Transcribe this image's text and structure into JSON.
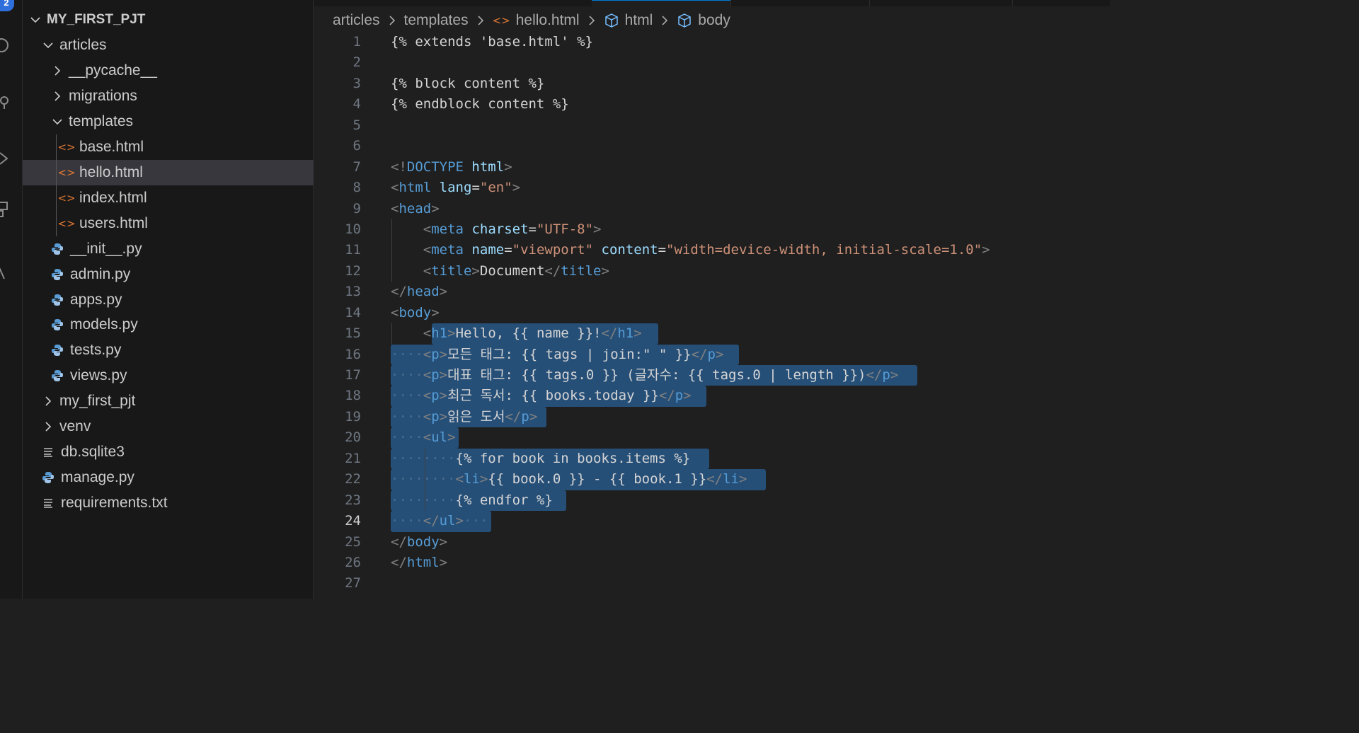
{
  "activity_bar": {
    "badge": "2",
    "icons": [
      "search-icon",
      "source-control-icon",
      "run-debug-icon",
      "extensions-icon",
      "testing-icon"
    ]
  },
  "explorer": {
    "root": "MY_FIRST_PJT",
    "items": [
      {
        "label": "articles",
        "kind": "folder-open",
        "name": "tree-folder-articles"
      },
      {
        "label": "__pycache__",
        "kind": "folder",
        "name": "tree-folder-pycache"
      },
      {
        "label": "migrations",
        "kind": "folder",
        "name": "tree-folder-migrations"
      },
      {
        "label": "templates",
        "kind": "folder-open",
        "name": "tree-folder-templates"
      },
      {
        "label": "base.html",
        "kind": "html",
        "name": "tree-file-base-html"
      },
      {
        "label": "hello.html",
        "kind": "html",
        "name": "tree-file-hello-html",
        "selected": true
      },
      {
        "label": "index.html",
        "kind": "html",
        "name": "tree-file-index-html"
      },
      {
        "label": "users.html",
        "kind": "html",
        "name": "tree-file-users-html"
      },
      {
        "label": "__init__.py",
        "kind": "python",
        "name": "tree-file-init-py"
      },
      {
        "label": "admin.py",
        "kind": "python",
        "name": "tree-file-admin-py"
      },
      {
        "label": "apps.py",
        "kind": "python",
        "name": "tree-file-apps-py"
      },
      {
        "label": "models.py",
        "kind": "python",
        "name": "tree-file-models-py"
      },
      {
        "label": "tests.py",
        "kind": "python",
        "name": "tree-file-tests-py"
      },
      {
        "label": "views.py",
        "kind": "python",
        "name": "tree-file-views-py"
      },
      {
        "label": "my_first_pjt",
        "kind": "folder",
        "name": "tree-folder-my-first-pjt"
      },
      {
        "label": "venv",
        "kind": "folder",
        "name": "tree-folder-venv"
      },
      {
        "label": "db.sqlite3",
        "kind": "text",
        "name": "tree-file-db-sqlite3"
      },
      {
        "label": "manage.py",
        "kind": "python",
        "name": "tree-file-manage-py"
      },
      {
        "label": "requirements.txt",
        "kind": "text",
        "name": "tree-file-requirements-txt"
      }
    ]
  },
  "breadcrumb": {
    "items": [
      {
        "label": "articles",
        "icon": ""
      },
      {
        "label": "templates",
        "icon": ""
      },
      {
        "label": "hello.html",
        "icon": "html-file-icon"
      },
      {
        "label": "html",
        "icon": "symbol-element-icon"
      },
      {
        "label": "body",
        "icon": "symbol-element-icon"
      }
    ]
  },
  "editor": {
    "current_line": 24,
    "lines": [
      {
        "n": "1",
        "segs": [
          [
            "{% extends 'base.html' %}",
            "text"
          ]
        ]
      },
      {
        "n": "2",
        "segs": []
      },
      {
        "n": "3",
        "segs": [
          [
            "{% block content %}",
            "text"
          ]
        ]
      },
      {
        "n": "4",
        "segs": [
          [
            "{% endblock content %}",
            "text"
          ]
        ]
      },
      {
        "n": "5",
        "segs": []
      },
      {
        "n": "6",
        "segs": []
      },
      {
        "n": "7",
        "segs": [
          [
            "<!",
            "br"
          ],
          [
            "DOCTYPE",
            "tag"
          ],
          [
            " ",
            "text"
          ],
          [
            "html",
            "attr"
          ],
          [
            ">",
            "br"
          ]
        ]
      },
      {
        "n": "8",
        "segs": [
          [
            "<",
            "br"
          ],
          [
            "html",
            "tag"
          ],
          [
            " ",
            "text"
          ],
          [
            "lang",
            "attr"
          ],
          [
            "=",
            "text"
          ],
          [
            "\"en\"",
            "str"
          ],
          [
            ">",
            "br"
          ]
        ]
      },
      {
        "n": "9",
        "segs": [
          [
            "<",
            "br"
          ],
          [
            "head",
            "tag"
          ],
          [
            ">",
            "br"
          ]
        ]
      },
      {
        "n": "10",
        "segs": [
          [
            "    ",
            "text"
          ],
          [
            "<",
            "br"
          ],
          [
            "meta",
            "tag"
          ],
          [
            " ",
            "text"
          ],
          [
            "charset",
            "attr"
          ],
          [
            "=",
            "text"
          ],
          [
            "\"UTF-8\"",
            "str"
          ],
          [
            ">",
            "br"
          ]
        ]
      },
      {
        "n": "11",
        "segs": [
          [
            "    ",
            "text"
          ],
          [
            "<",
            "br"
          ],
          [
            "meta",
            "tag"
          ],
          [
            " ",
            "text"
          ],
          [
            "name",
            "attr"
          ],
          [
            "=",
            "text"
          ],
          [
            "\"viewport\"",
            "str"
          ],
          [
            " ",
            "text"
          ],
          [
            "content",
            "attr"
          ],
          [
            "=",
            "text"
          ],
          [
            "\"width=device-width, initial-scale=1.0\"",
            "str"
          ],
          [
            ">",
            "br"
          ]
        ]
      },
      {
        "n": "12",
        "segs": [
          [
            "    ",
            "text"
          ],
          [
            "<",
            "br"
          ],
          [
            "title",
            "tag"
          ],
          [
            ">",
            "br"
          ],
          [
            "Document",
            "text"
          ],
          [
            "</",
            "br"
          ],
          [
            "title",
            "tag"
          ],
          [
            ">",
            "br"
          ]
        ]
      },
      {
        "n": "13",
        "segs": [
          [
            "</",
            "br"
          ],
          [
            "head",
            "tag"
          ],
          [
            ">",
            "br"
          ]
        ]
      },
      {
        "n": "14",
        "segs": [
          [
            "<",
            "br"
          ],
          [
            "body",
            "tag"
          ],
          [
            ">",
            "br"
          ]
        ]
      },
      {
        "n": "15",
        "segs": [
          [
            "    ",
            "text"
          ],
          [
            "<",
            "br"
          ],
          [
            "h1",
            "tag"
          ],
          [
            ">",
            "br"
          ],
          [
            "Hello, {{ name }}!",
            "text"
          ],
          [
            "</",
            "br"
          ],
          [
            "h1",
            "tag"
          ],
          [
            ">",
            "br"
          ]
        ]
      },
      {
        "n": "16",
        "segs": [
          [
            "····",
            "dot"
          ],
          [
            "<",
            "br"
          ],
          [
            "p",
            "tag"
          ],
          [
            ">",
            "br"
          ],
          [
            "모든 태그: {{ tags | join:\" \" }}",
            "text"
          ],
          [
            "</",
            "br"
          ],
          [
            "p",
            "tag"
          ],
          [
            ">",
            "br"
          ]
        ]
      },
      {
        "n": "17",
        "segs": [
          [
            "····",
            "dot"
          ],
          [
            "<",
            "br"
          ],
          [
            "p",
            "tag"
          ],
          [
            ">",
            "br"
          ],
          [
            "대표 태그: {{ tags.0 }} (글자수: {{ tags.0 | length }})",
            "text"
          ],
          [
            "</",
            "br"
          ],
          [
            "p",
            "tag"
          ],
          [
            ">",
            "br"
          ]
        ]
      },
      {
        "n": "18",
        "segs": [
          [
            "····",
            "dot"
          ],
          [
            "<",
            "br"
          ],
          [
            "p",
            "tag"
          ],
          [
            ">",
            "br"
          ],
          [
            "최근 독서: {{ books.today }}",
            "text"
          ],
          [
            "</",
            "br"
          ],
          [
            "p",
            "tag"
          ],
          [
            ">",
            "br"
          ]
        ]
      },
      {
        "n": "19",
        "segs": [
          [
            "····",
            "dot"
          ],
          [
            "<",
            "br"
          ],
          [
            "p",
            "tag"
          ],
          [
            ">",
            "br"
          ],
          [
            "읽은 도서",
            "text"
          ],
          [
            "</",
            "br"
          ],
          [
            "p",
            "tag"
          ],
          [
            ">",
            "br"
          ]
        ]
      },
      {
        "n": "20",
        "segs": [
          [
            "····",
            "dot"
          ],
          [
            "<",
            "br"
          ],
          [
            "ul",
            "tag"
          ],
          [
            ">",
            "br"
          ]
        ]
      },
      {
        "n": "21",
        "segs": [
          [
            "········",
            "dot"
          ],
          [
            "{% for book in books.items %}",
            "text"
          ]
        ]
      },
      {
        "n": "22",
        "segs": [
          [
            "········",
            "dot"
          ],
          [
            "<",
            "br"
          ],
          [
            "li",
            "tag"
          ],
          [
            ">",
            "br"
          ],
          [
            "{{ book.0 }} - {{ book.1 }}",
            "text"
          ],
          [
            "</",
            "br"
          ],
          [
            "li",
            "tag"
          ],
          [
            ">",
            "br"
          ]
        ]
      },
      {
        "n": "23",
        "segs": [
          [
            "········",
            "dot"
          ],
          [
            "{% endfor %}",
            "text"
          ]
        ]
      },
      {
        "n": "24",
        "segs": [
          [
            "····",
            "dot"
          ],
          [
            "</",
            "br"
          ],
          [
            "ul",
            "tag"
          ],
          [
            ">",
            "br"
          ],
          [
            "···",
            "dot"
          ]
        ]
      },
      {
        "n": "25",
        "segs": [
          [
            "</",
            "br"
          ],
          [
            "body",
            "tag"
          ],
          [
            ">",
            "br"
          ]
        ]
      },
      {
        "n": "26",
        "segs": [
          [
            "</",
            "br"
          ],
          [
            "html",
            "tag"
          ],
          [
            ">",
            "br"
          ]
        ]
      },
      {
        "n": "27",
        "segs": []
      }
    ]
  }
}
